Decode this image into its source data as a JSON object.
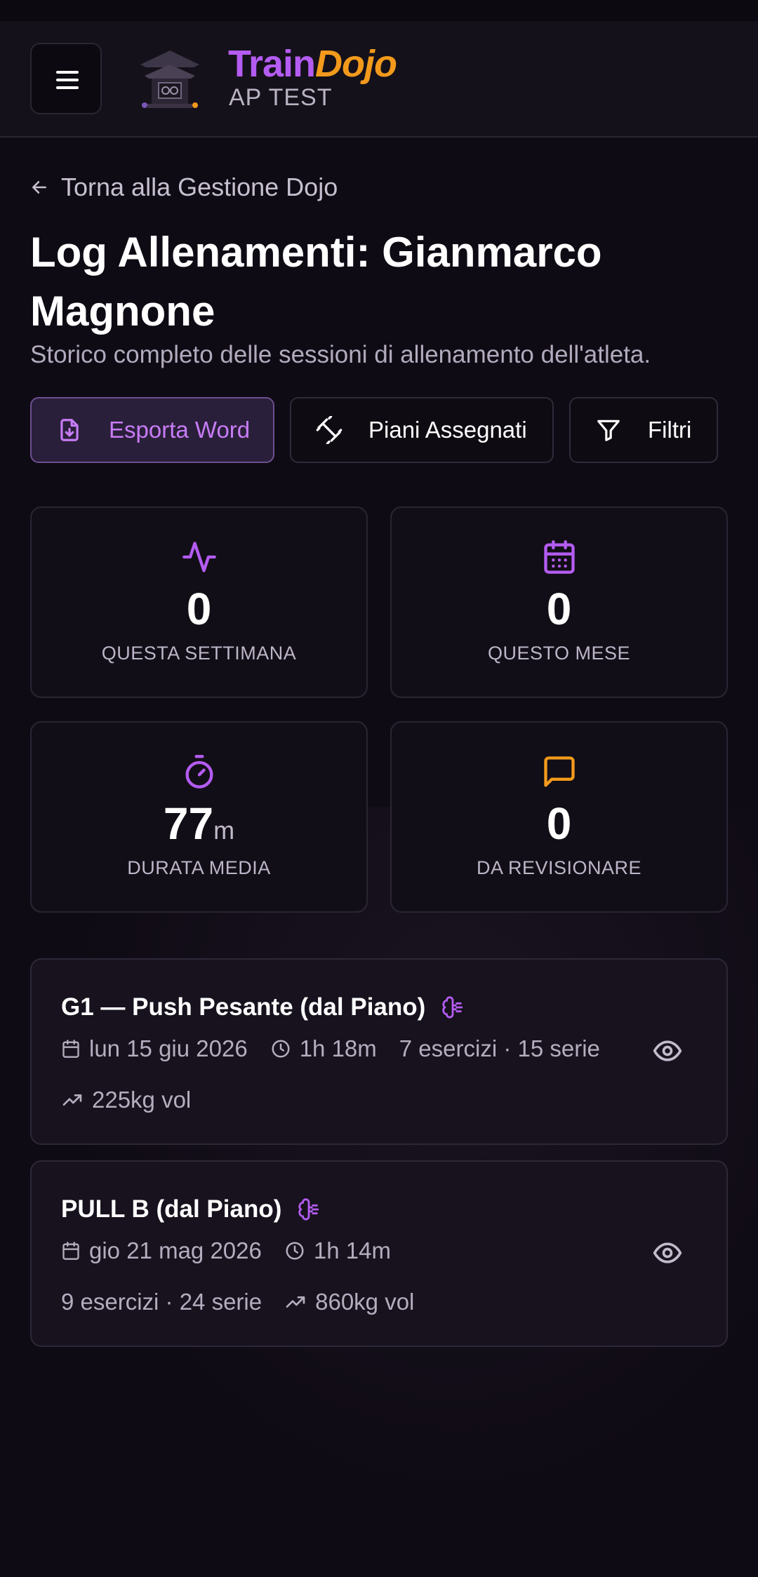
{
  "header": {
    "brand_part1": "Train",
    "brand_part2": "Dojo",
    "subtitle": "AP TEST",
    "menu_icon": "hamburger-icon",
    "logo": "dojo-temple-logo"
  },
  "back_link": {
    "label": "Torna alla Gestione Dojo",
    "icon": "arrow-left-icon"
  },
  "page": {
    "title": "Log Allenamenti: Gianmarco Magnone",
    "subtitle": "Storico completo delle sessioni di allenamento dell'atleta."
  },
  "actions": [
    {
      "label": "Esporta Word",
      "icon": "file-download-icon"
    },
    {
      "label": "Piani Assegnati",
      "icon": "dumbbell-icon"
    },
    {
      "label": "Filtri",
      "icon": "filter-icon"
    }
  ],
  "stats": [
    {
      "value": "0",
      "unit": "",
      "label": "QUESTA SETTIMANA",
      "icon": "activity-icon",
      "color": "#b45cf2"
    },
    {
      "value": "0",
      "unit": "",
      "label": "QUESTO MESE",
      "icon": "calendar-icon",
      "color": "#b45cf2"
    },
    {
      "value": "77",
      "unit": "m",
      "label": "DURATA MEDIA",
      "icon": "timer-icon",
      "color": "#b45cf2"
    },
    {
      "value": "0",
      "unit": "",
      "label": "DA REVISIONARE",
      "icon": "message-square-icon",
      "color": "#f39a1c"
    }
  ],
  "sessions": [
    {
      "title": "G1 — Push Pesante (dal Piano)",
      "date": "lun 15 giu 2026",
      "duration": "1h 18m",
      "exercises": "7 esercizi · 15 serie",
      "volume": "225kg vol"
    },
    {
      "title": "PULL B (dal Piano)",
      "date": "gio 21 mag 2026",
      "duration": "1h 14m",
      "exercises": "9 esercizi · 24 serie",
      "volume": "860kg vol"
    }
  ],
  "colors": {
    "accent": "#b45cf2",
    "orange": "#f39a1c",
    "background": "#0f0b14"
  }
}
